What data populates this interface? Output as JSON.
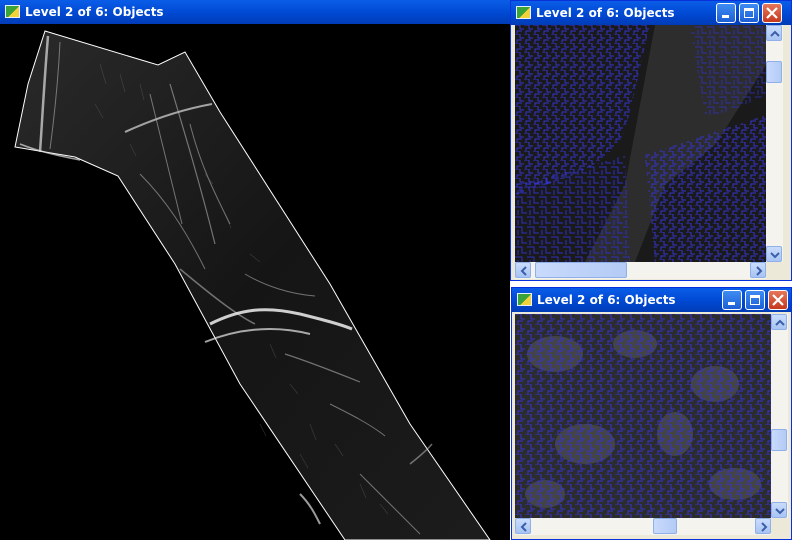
{
  "windows": {
    "main": {
      "title": "Level 2 of 6: Objects"
    },
    "top_right": {
      "title": "Level 2 of 6: Objects"
    },
    "bottom_right": {
      "title": "Level 2 of 6: Objects"
    }
  },
  "icons": {
    "app": "app-image-icon",
    "minimize": "minimize-icon",
    "maximize": "maximize-icon",
    "close": "close-icon",
    "up": "arrow-up-icon",
    "down": "arrow-down-icon",
    "left": "arrow-left-icon",
    "right": "arrow-right-icon"
  },
  "colors": {
    "title_bar": "#0054e3",
    "object_outline": "#3232c8",
    "image_background": "#000000",
    "close_button": "#d8543b"
  }
}
